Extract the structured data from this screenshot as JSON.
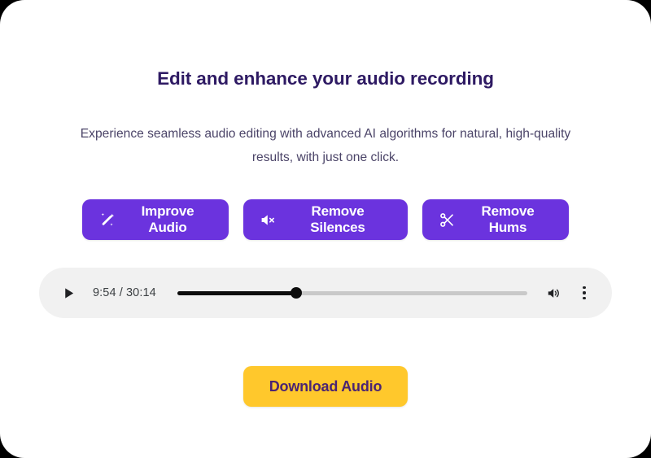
{
  "card": {
    "background_color": "#ffffff",
    "corner_radius_px": 30
  },
  "heading": {
    "text": "Edit and enhance your audio recording",
    "color": "#2e1a63"
  },
  "subtitle": {
    "text": "Experience seamless audio editing with advanced AI algorithms for natural, high-quality results, with just one click.",
    "color": "#4b4468"
  },
  "colors": {
    "accent_purple": "#6b33de",
    "accent_yellow": "#ffc82c",
    "heading_purple": "#2e1a63",
    "player_background": "#f1f1f1",
    "seek_filled": "#0d0d0d",
    "seek_remaining": "#c9c9c9"
  },
  "actions": [
    {
      "label": "Improve Audio",
      "icon": "magic-wand-icon",
      "name": "improve-audio-button"
    },
    {
      "label": "Remove Silences",
      "icon": "speaker-muted-icon",
      "name": "remove-silences-button"
    },
    {
      "label": "Remove Hums",
      "icon": "scissors-icon",
      "name": "remove-hums-button"
    }
  ],
  "player": {
    "play_icon": "play-icon",
    "current_time": "9:54",
    "total_time": "30:14",
    "time_display": "9:54 / 30:14",
    "progress_percent": 34,
    "volume_icon": "volume-on-icon",
    "more_options_icon": "kebab-menu-icon"
  },
  "download": {
    "label": "Download Audio"
  }
}
